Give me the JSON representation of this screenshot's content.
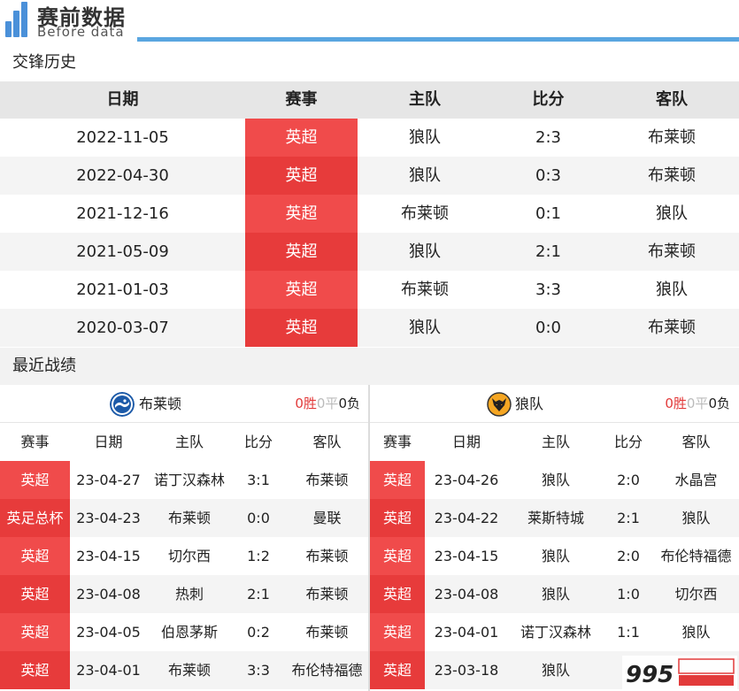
{
  "header": {
    "title": "赛前数据",
    "subtitle": "Before data"
  },
  "h2h": {
    "section_title": "交锋历史",
    "columns": [
      "日期",
      "赛事",
      "主队",
      "比分",
      "客队"
    ],
    "rows": [
      {
        "date": "2022-11-05",
        "comp": "英超",
        "home": "狼队",
        "score": "2:3",
        "away": "布莱顿"
      },
      {
        "date": "2022-04-30",
        "comp": "英超",
        "home": "狼队",
        "score": "0:3",
        "away": "布莱顿"
      },
      {
        "date": "2021-12-16",
        "comp": "英超",
        "home": "布莱顿",
        "score": "0:1",
        "away": "狼队"
      },
      {
        "date": "2021-05-09",
        "comp": "英超",
        "home": "狼队",
        "score": "2:1",
        "away": "布莱顿"
      },
      {
        "date": "2021-01-03",
        "comp": "英超",
        "home": "布莱顿",
        "score": "3:3",
        "away": "狼队"
      },
      {
        "date": "2020-03-07",
        "comp": "英超",
        "home": "狼队",
        "score": "0:0",
        "away": "布莱顿"
      }
    ]
  },
  "recent": {
    "section_title": "最近战绩",
    "columns": [
      "赛事",
      "日期",
      "主队",
      "比分",
      "客队"
    ],
    "teams": [
      {
        "name": "布莱顿",
        "badge_icon": "brighton-badge-icon",
        "record": {
          "wins": "0",
          "win_label": "胜",
          "draws": "0",
          "draw_label": "平",
          "losses": "0",
          "loss_label": "负"
        },
        "matches": [
          {
            "comp": "英超",
            "date": "23-04-27",
            "home": "诺丁汉森林",
            "score": "3:1",
            "away": "布莱顿"
          },
          {
            "comp": "英足总杯",
            "date": "23-04-23",
            "home": "布莱顿",
            "score": "0:0",
            "away": "曼联"
          },
          {
            "comp": "英超",
            "date": "23-04-15",
            "home": "切尔西",
            "score": "1:2",
            "away": "布莱顿"
          },
          {
            "comp": "英超",
            "date": "23-04-08",
            "home": "热刺",
            "score": "2:1",
            "away": "布莱顿"
          },
          {
            "comp": "英超",
            "date": "23-04-05",
            "home": "伯恩茅斯",
            "score": "0:2",
            "away": "布莱顿"
          },
          {
            "comp": "英超",
            "date": "23-04-01",
            "home": "布莱顿",
            "score": "3:3",
            "away": "布伦特福德"
          }
        ]
      },
      {
        "name": "狼队",
        "badge_icon": "wolves-badge-icon",
        "record": {
          "wins": "0",
          "win_label": "胜",
          "draws": "0",
          "draw_label": "平",
          "losses": "0",
          "loss_label": "负"
        },
        "matches": [
          {
            "comp": "英超",
            "date": "23-04-26",
            "home": "狼队",
            "score": "2:0",
            "away": "水晶宫"
          },
          {
            "comp": "英超",
            "date": "23-04-22",
            "home": "莱斯特城",
            "score": "2:1",
            "away": "狼队"
          },
          {
            "comp": "英超",
            "date": "23-04-15",
            "home": "狼队",
            "score": "2:0",
            "away": "布伦特福德"
          },
          {
            "comp": "英超",
            "date": "23-04-08",
            "home": "狼队",
            "score": "1:0",
            "away": "切尔西"
          },
          {
            "comp": "英超",
            "date": "23-04-01",
            "home": "诺丁汉森林",
            "score": "1:1",
            "away": "狼队"
          },
          {
            "comp": "英超",
            "date": "23-03-18",
            "home": "狼队",
            "score": "",
            "away": ""
          }
        ]
      }
    ]
  },
  "colors": {
    "accent_blue": "#5aa6e0",
    "comp_red": "#f04b4b",
    "comp_red_dark": "#e73b3b",
    "win_red": "#e23a3a"
  }
}
